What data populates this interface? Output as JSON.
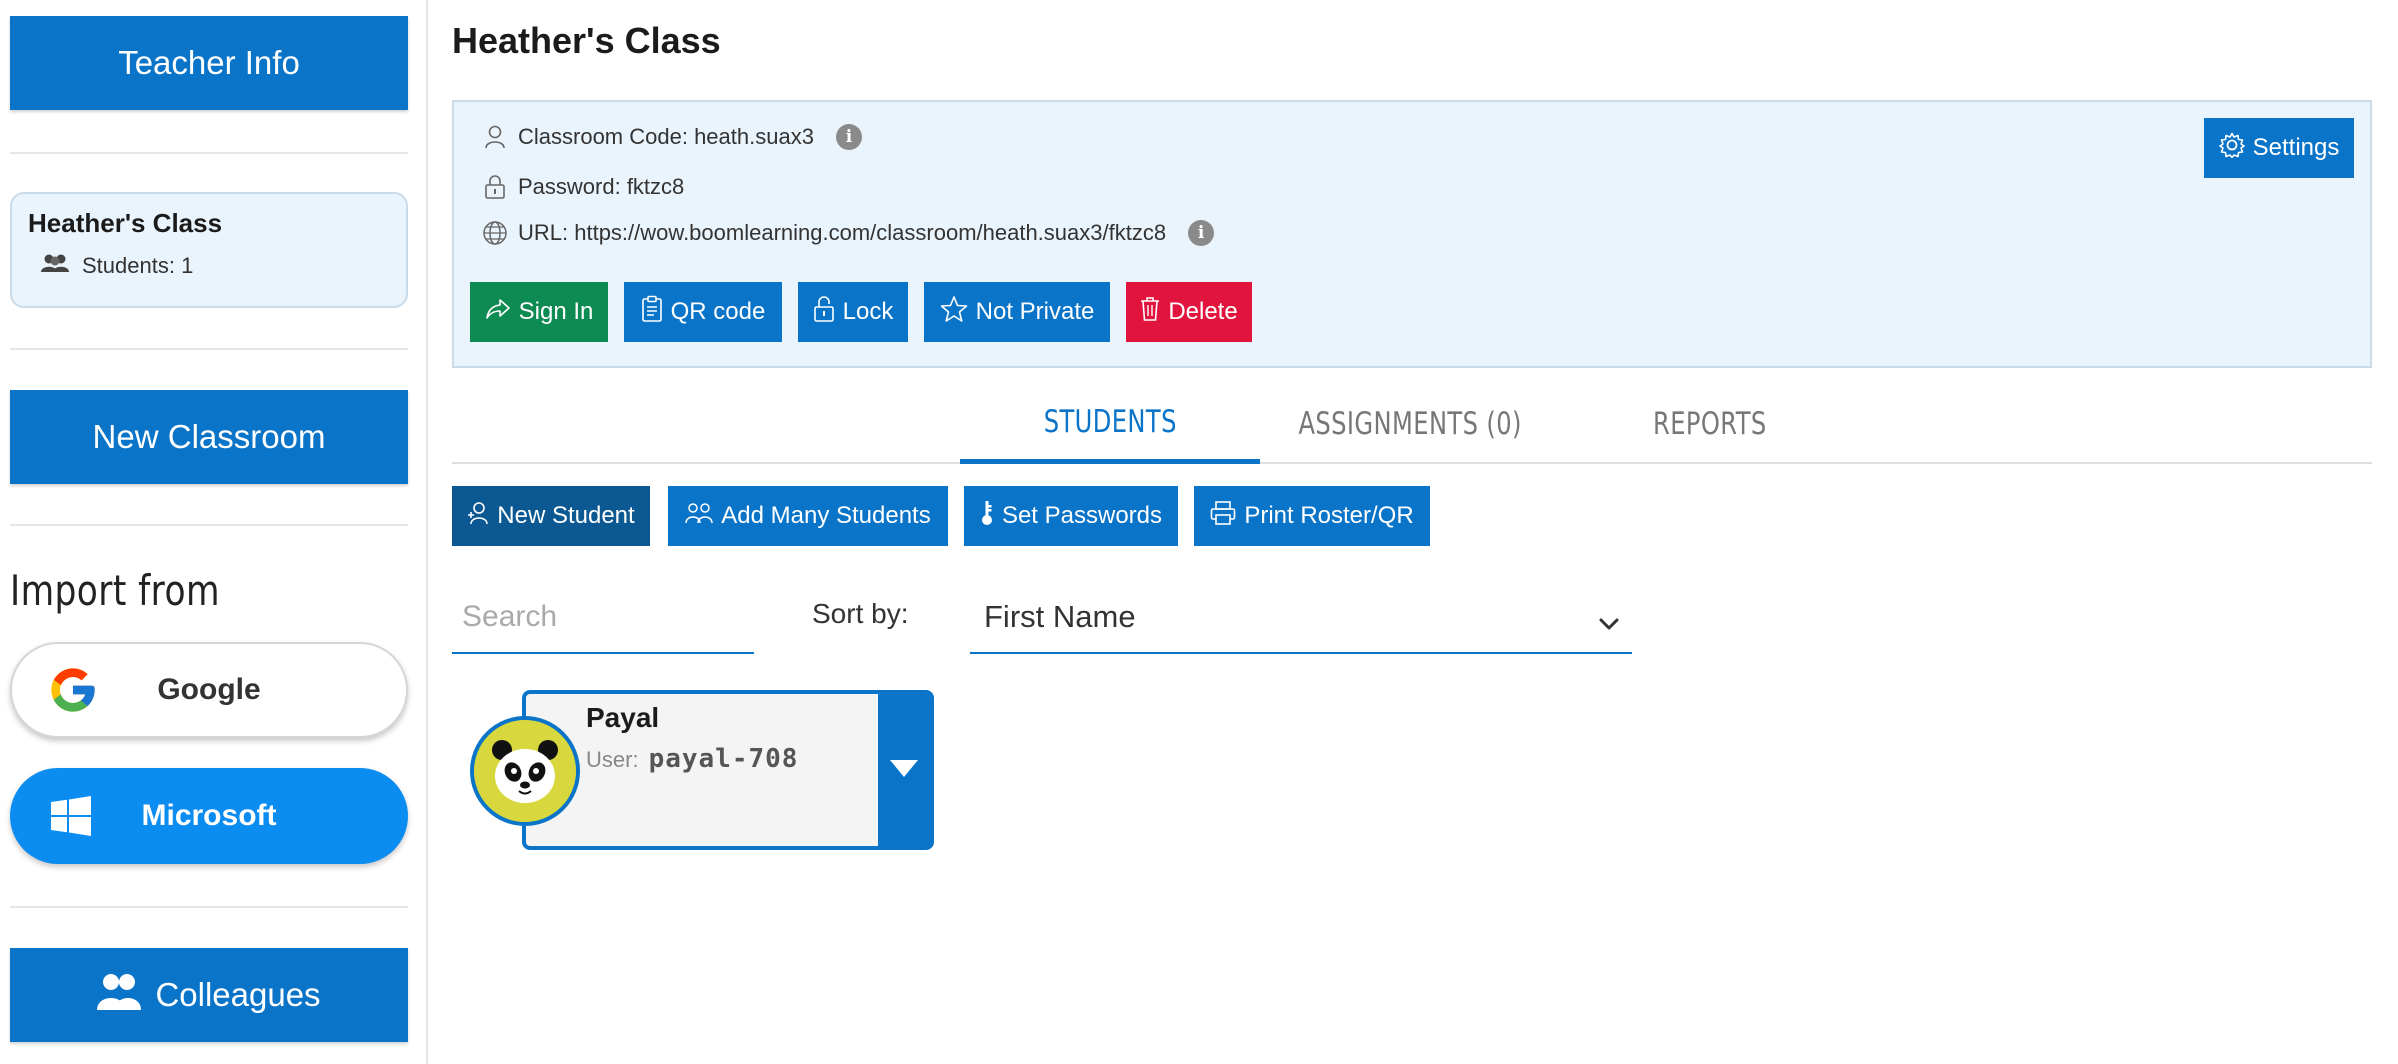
{
  "sidebar": {
    "teacher_info_label": "Teacher Info",
    "class_card": {
      "title": "Heather's Class",
      "students_label": "Students: 1"
    },
    "new_classroom_label": "New Classroom",
    "import_title": "Import from",
    "google_label": "Google",
    "microsoft_label": "Microsoft",
    "colleagues_label": "Colleagues"
  },
  "main": {
    "title": "Heather's Class",
    "info": {
      "classroom_code": "Classroom Code: heath.suax3",
      "password": "Password: fktzc8",
      "url": "URL: https://wow.boomlearning.com/classroom/heath.suax3/fktzc8",
      "info_glyph": "i"
    },
    "settings_label": "Settings",
    "actions": {
      "sign_in": "Sign In",
      "qr_code": "QR code",
      "lock": "Lock",
      "not_private": "Not Private",
      "delete": "Delete"
    },
    "tabs": [
      {
        "label": "STUDENTS",
        "active": true
      },
      {
        "label": "ASSIGNMENTS (0)",
        "active": false
      },
      {
        "label": "REPORTS",
        "active": false
      }
    ],
    "toolbar": {
      "new_student": "New Student",
      "add_many": "Add Many Students",
      "set_passwords": "Set Passwords",
      "print_roster": "Print Roster/QR"
    },
    "search_placeholder": "Search",
    "sort_label": "Sort by:",
    "sort_value": "First Name",
    "students": [
      {
        "name": "Payal",
        "user_label": "User:",
        "username": "payal-708",
        "avatar": "panda"
      }
    ]
  },
  "colors": {
    "primary": "#0a74c9",
    "primary_dark": "#0b5892",
    "success": "#0e8a53",
    "danger": "#e0143c",
    "microsoft": "#0a8cf0",
    "panel_bg": "#eaf4fc"
  }
}
